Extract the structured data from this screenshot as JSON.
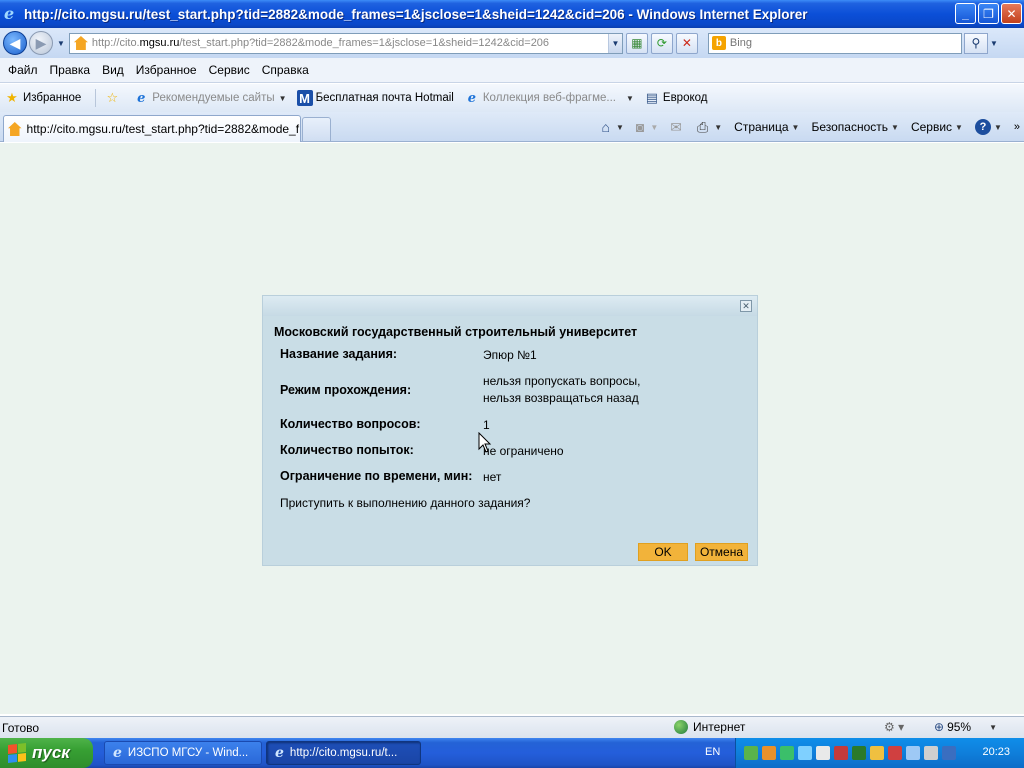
{
  "window": {
    "title": "http://cito.mgsu.ru/test_start.php?tid=2882&mode_frames=1&jsclose=1&sheid=1242&cid=206 - Windows Internet Explorer"
  },
  "address_bar": {
    "url_prefix": "http://cito.",
    "url_domain": "mgsu.ru",
    "url_path": "/test_start.php?tid=2882&mode_frames=1&jsclose=1&sheid=1242&cid=206"
  },
  "search": {
    "placeholder": "Bing"
  },
  "menu": [
    "Файл",
    "Правка",
    "Вид",
    "Избранное",
    "Сервис",
    "Справка"
  ],
  "favorites_bar": {
    "favorites_label": "Избранное",
    "items": [
      {
        "label": "Рекомендуемые сайты"
      },
      {
        "label": "Бесплатная почта Hotmail"
      },
      {
        "label": "Коллекция веб-фрагме..."
      },
      {
        "label": "Еврокод"
      }
    ]
  },
  "tab": {
    "label": "http://cito.mgsu.ru/test_start.php?tid=2882&mode_f..."
  },
  "command_bar": {
    "page": "Страница",
    "safety": "Безопасность",
    "tools": "Сервис"
  },
  "dialog": {
    "heading": "Московский государственный строительный университет",
    "fields": [
      {
        "label": "Название задания:",
        "value": "Эпюр №1"
      },
      {
        "label": "Режим прохождения:",
        "value": "нельзя пропускать вопросы,",
        "value2": "нельзя возвращаться назад"
      },
      {
        "label": "Количество вопросов:",
        "value": "1"
      },
      {
        "label": "Количество попыток:",
        "value": "не ограничено"
      },
      {
        "label": "Ограничение по времени, мин:",
        "value": "нет"
      }
    ],
    "question": "Приступить к выполнению данного задания?",
    "ok_label": "OK",
    "cancel_label": "Отмена"
  },
  "status_bar": {
    "status": "Готово",
    "zone": "Интернет",
    "zoom": "95%"
  },
  "taskbar": {
    "start_label": "пуск",
    "tasks": [
      {
        "label": "ИЗСПО МГСУ - Wind..."
      },
      {
        "label": "http://cito.mgsu.ru/t..."
      }
    ],
    "language": "EN",
    "clock": "20:23"
  }
}
